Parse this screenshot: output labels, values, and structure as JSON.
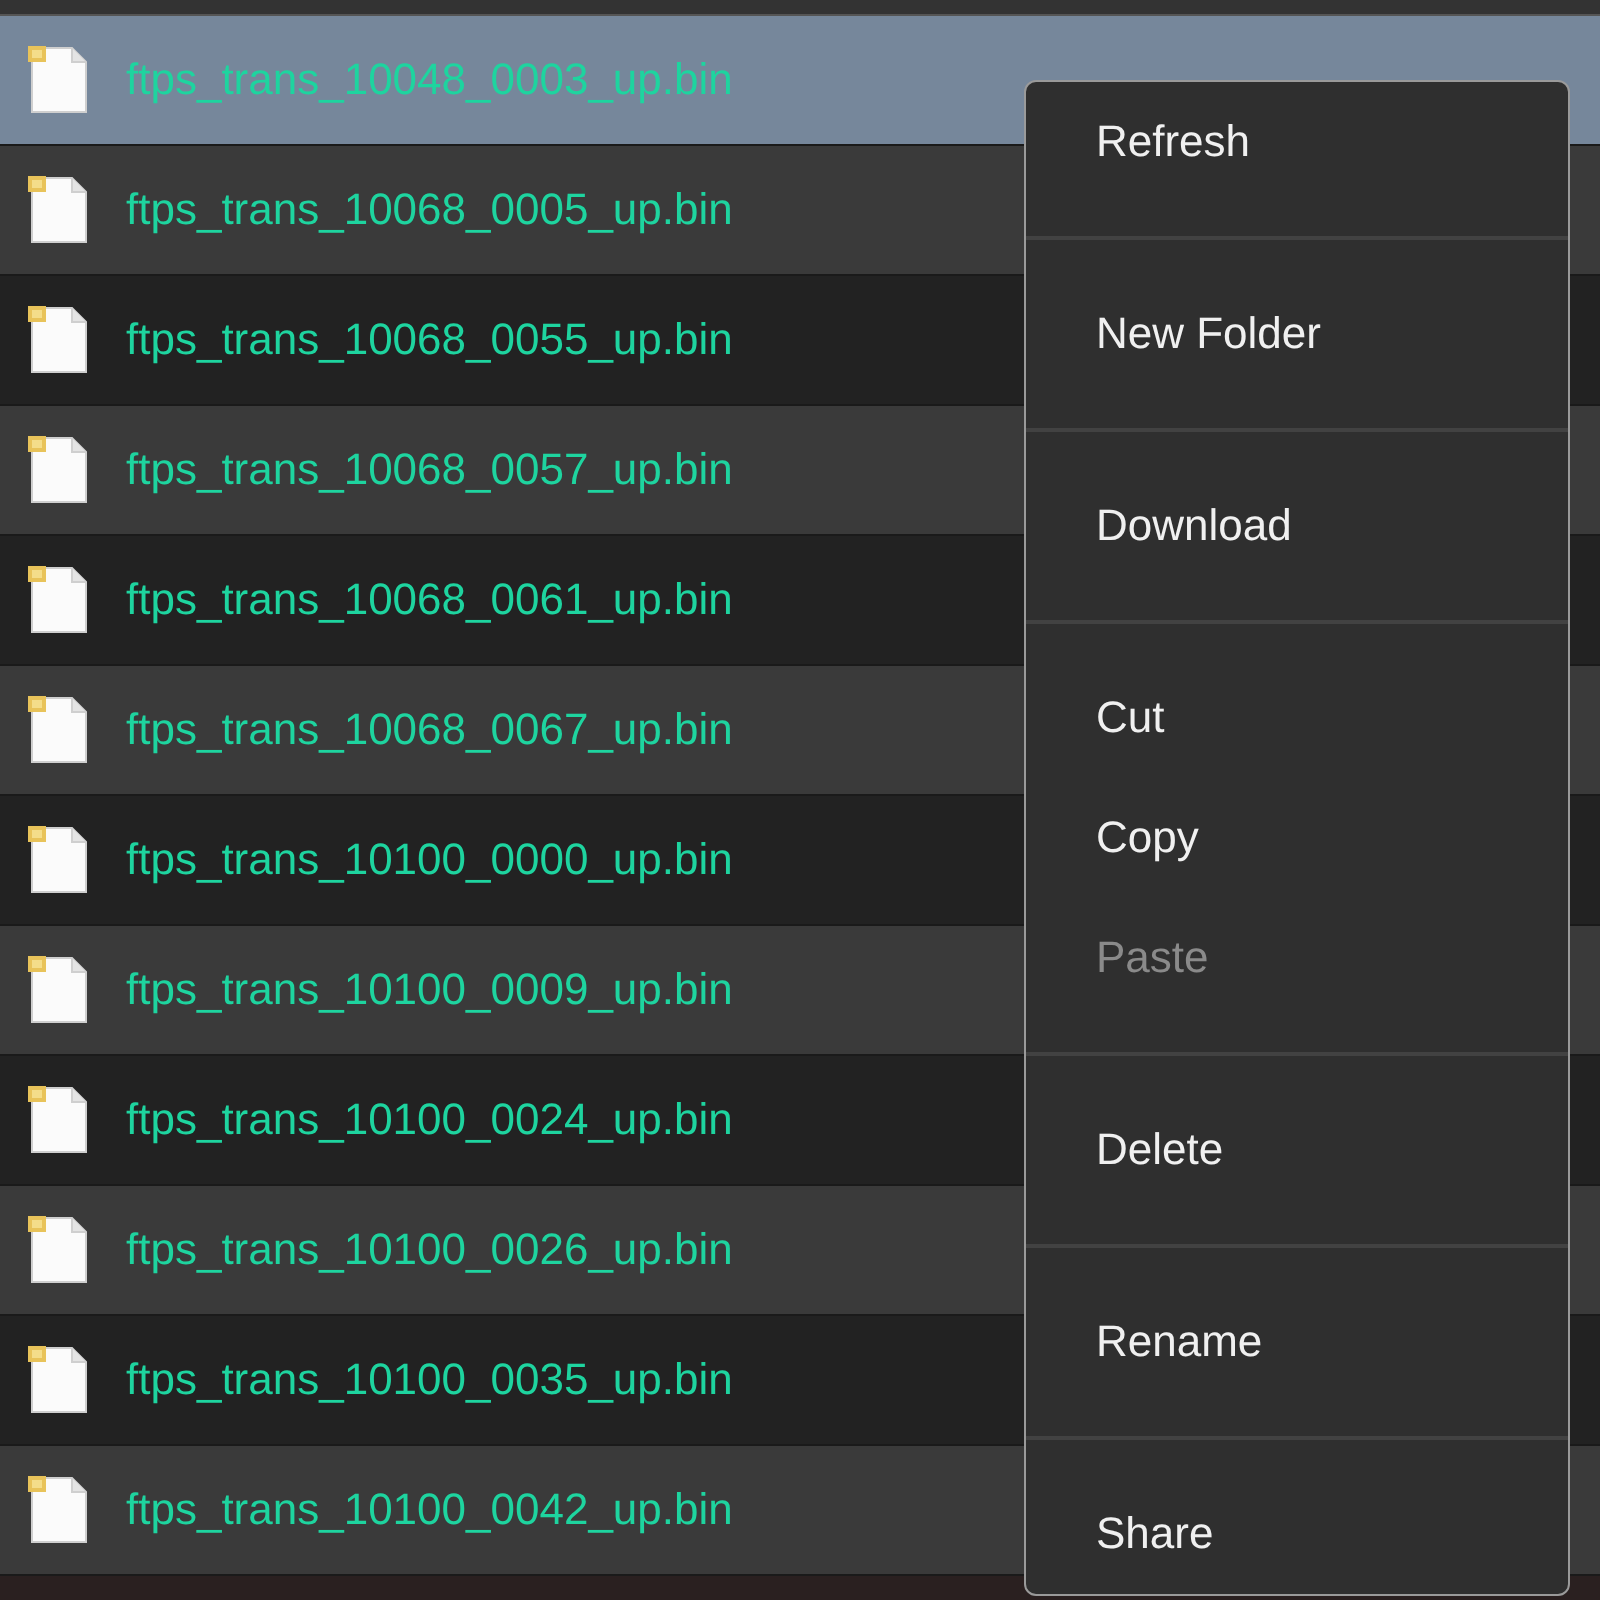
{
  "files": [
    {
      "name": "ftps_trans_10048_0003_up.bin",
      "selected": true
    },
    {
      "name": "ftps_trans_10068_0005_up.bin",
      "selected": false
    },
    {
      "name": "ftps_trans_10068_0055_up.bin",
      "selected": false
    },
    {
      "name": "ftps_trans_10068_0057_up.bin",
      "selected": false
    },
    {
      "name": "ftps_trans_10068_0061_up.bin",
      "selected": false
    },
    {
      "name": "ftps_trans_10068_0067_up.bin",
      "selected": false
    },
    {
      "name": "ftps_trans_10100_0000_up.bin",
      "selected": false
    },
    {
      "name": "ftps_trans_10100_0009_up.bin",
      "selected": false
    },
    {
      "name": "ftps_trans_10100_0024_up.bin",
      "selected": false
    },
    {
      "name": "ftps_trans_10100_0026_up.bin",
      "selected": false
    },
    {
      "name": "ftps_trans_10100_0035_up.bin",
      "selected": false
    },
    {
      "name": "ftps_trans_10100_0042_up.bin",
      "selected": false
    }
  ],
  "context_menu": {
    "sections": [
      {
        "items": [
          {
            "label": "Refresh",
            "disabled": false
          }
        ]
      },
      {
        "items": [
          {
            "label": "New Folder",
            "disabled": false
          }
        ]
      },
      {
        "items": [
          {
            "label": "Download",
            "disabled": false
          }
        ]
      },
      {
        "items": [
          {
            "label": "Cut",
            "disabled": false
          },
          {
            "label": "Copy",
            "disabled": false
          },
          {
            "label": "Paste",
            "disabled": true
          }
        ]
      },
      {
        "items": [
          {
            "label": "Delete",
            "disabled": false
          }
        ]
      },
      {
        "items": [
          {
            "label": "Rename",
            "disabled": false
          }
        ]
      },
      {
        "items": [
          {
            "label": "Share",
            "disabled": false
          }
        ]
      }
    ]
  }
}
